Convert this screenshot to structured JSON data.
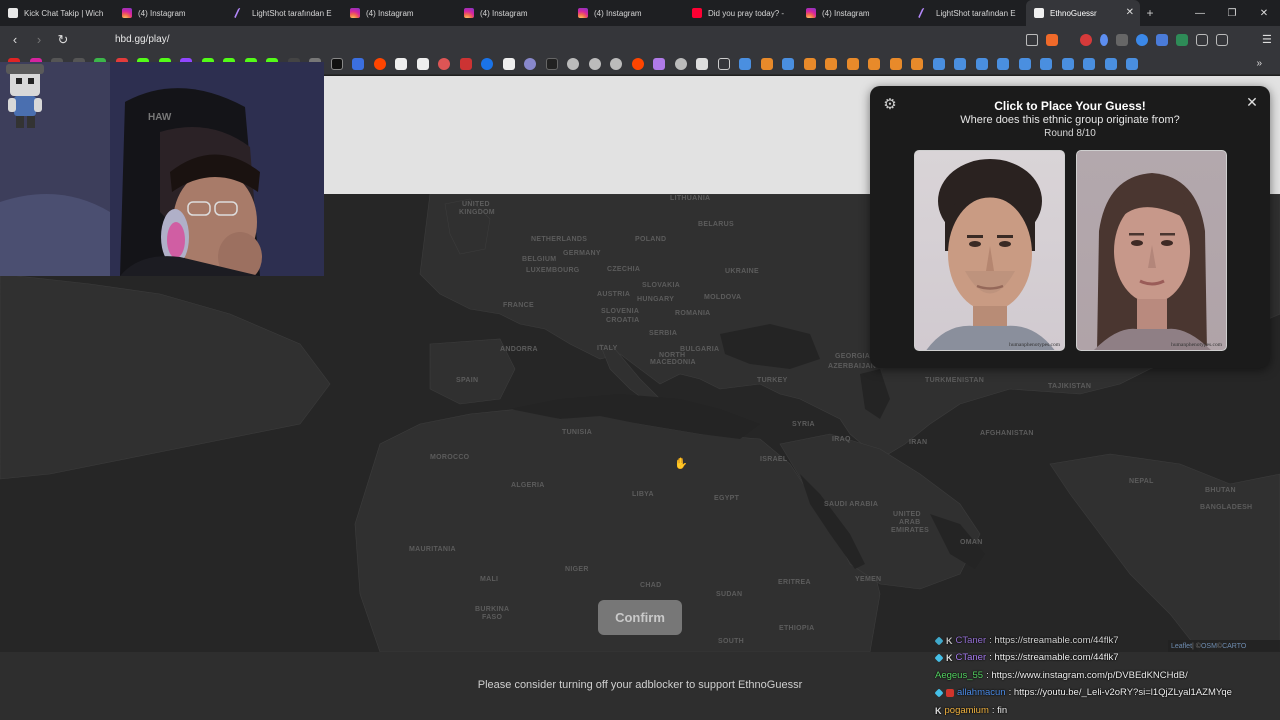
{
  "browser": {
    "tabs": [
      {
        "label": "Kick Chat Takip | Wich",
        "icon": "kick-icon"
      },
      {
        "label": "(4) Instagram",
        "icon": "instagram-icon"
      },
      {
        "label": "LightShot tarafından E",
        "icon": "lightshot-icon"
      },
      {
        "label": "(4) Instagram",
        "icon": "instagram-icon"
      },
      {
        "label": "(4) Instagram",
        "icon": "instagram-icon"
      },
      {
        "label": "(4) Instagram",
        "icon": "instagram-icon"
      },
      {
        "label": "Did you pray today? -",
        "icon": "youtube-icon"
      },
      {
        "label": "(4) Instagram",
        "icon": "instagram-icon"
      },
      {
        "label": "LightShot tarafından E",
        "icon": "lightshot-icon"
      },
      {
        "label": "EthnoGuessr",
        "icon": "ethnoguessr-icon",
        "active": true
      }
    ],
    "new_tab": "+",
    "url": "hbd.gg/play/",
    "window_controls": {
      "minimize": "—",
      "maximize": "❐",
      "close": "✕"
    }
  },
  "game": {
    "prompt_title": "Click to Place Your Guess!",
    "prompt_question": "Where does this ethnic group originate from?",
    "round": "Round 8/10",
    "watermark_male": "humanphenotypes.com",
    "watermark_female": "humanphenotypes.com",
    "confirm_label": "Confirm",
    "attribution": {
      "leaflet": "Leaflet",
      "sep1": " | © ",
      "osm": "OSM",
      "sep2": " © ",
      "carto": "CARTO"
    },
    "footer_note": "Please consider turning off your adblocker to support EthnoGuessr",
    "map_labels": [
      "UNITED",
      "KINGDOM",
      "LITHUANIA",
      "BELARUS",
      "NETHERLANDS",
      "POLAND",
      "BELGIUM",
      "GERMANY",
      "LUXEMBOURG",
      "CZECHIA",
      "UKRAINE",
      "SLOVAKIA",
      "AUSTRIA",
      "HUNGARY",
      "MOLDOVA",
      "FRANCE",
      "SLOVENIA",
      "CROATIA",
      "ROMANIA",
      "SERBIA",
      "ANDORRA",
      "ITALY",
      "BULGARIA",
      "NORTH",
      "MACEDONIA",
      "GEORGIA",
      "AZERBAIJAN",
      "SPAIN",
      "TURKEY",
      "TURKMENISTAN",
      "TAJIKISTAN",
      "TUNISIA",
      "SYRIA",
      "IRAQ",
      "IRAN",
      "AFGHANISTAN",
      "MOROCCO",
      "ISRAEL",
      "ALGERIA",
      "LIBYA",
      "EGYPT",
      "SAUDI ARABIA",
      "UNITED",
      "ARAB",
      "EMIRATES",
      "NEPAL",
      "BHUTAN",
      "BANGLADESH",
      "MAURITANIA",
      "MALI",
      "NIGER",
      "CHAD",
      "SUDAN",
      "ERITREA",
      "YEMEN",
      "OMAN",
      "BURKINA",
      "FASO",
      "SOUTH",
      "ETHIOPIA"
    ],
    "colors": {
      "map_bg": "#262626",
      "land": "#2f2f2f",
      "panel_bg": "#1b1b1b",
      "confirm_bg": "#777777"
    }
  },
  "chat": [
    {
      "badges": [
        "cyan",
        "k"
      ],
      "user": "CTaner",
      "user_color": "#a77cf0",
      "message": "https://streamable.com/44flk7"
    },
    {
      "badges": [
        "cyan",
        "k"
      ],
      "user": "CTaner",
      "user_color": "#a77cf0",
      "message": "https://streamable.com/44flk7"
    },
    {
      "badges": [],
      "user": "Aegeus_55",
      "user_color": "#56d364",
      "message": "https://www.instagram.com/p/DVBEdKNCHdB/"
    },
    {
      "badges": [
        "cyan",
        "red"
      ],
      "user": "allahmacun",
      "user_color": "#4d8de8",
      "message": "https://youtu.be/_Leli-v2oRY?si=l1QjZLyal1AZMYqe"
    },
    {
      "badges": [
        "k"
      ],
      "user": "pogamium",
      "user_color": "#f5b642",
      "message": "fin"
    }
  ],
  "chat_separator": ":"
}
